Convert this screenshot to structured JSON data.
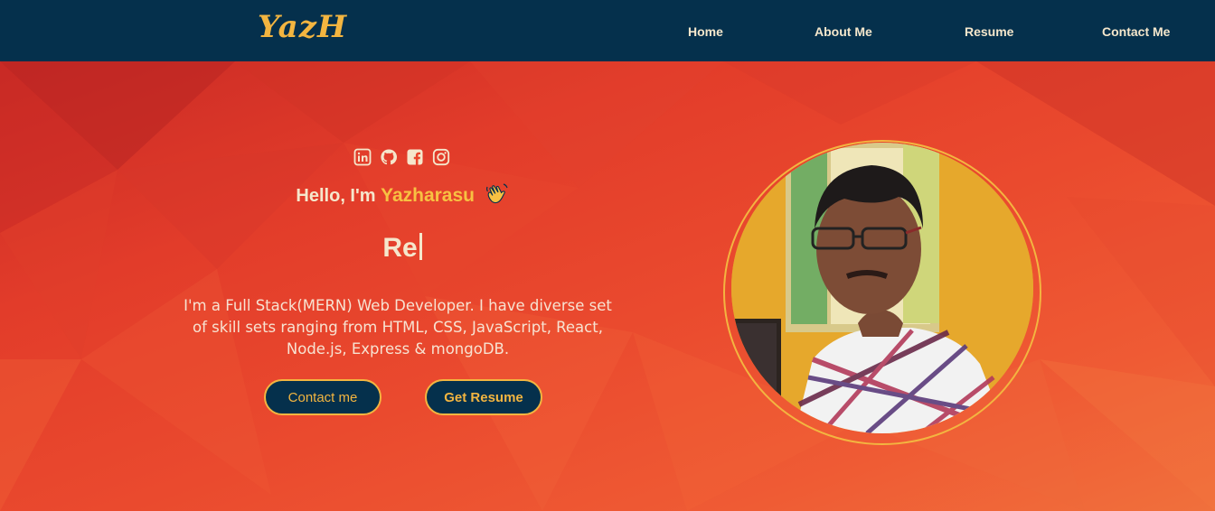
{
  "navbar": {
    "logo": "YazH",
    "links": [
      {
        "label": "Home"
      },
      {
        "label": "About Me"
      },
      {
        "label": "Resume"
      },
      {
        "label": "Contact Me"
      }
    ]
  },
  "hero": {
    "social_icons": [
      "linkedin-icon",
      "github-icon",
      "facebook-icon",
      "instagram-icon"
    ],
    "greeting_prefix": "Hello, I'm ",
    "greeting_name": "Yazharasu",
    "greeting_emoji": "waving-hand-icon",
    "typed_text": "Re",
    "bio": "I'm a Full Stack(MERN) Web Developer. I have diverse set of skill sets ranging from HTML, CSS, JavaScript, React, Node.js, Express & mongoDB.",
    "buttons": {
      "contact": "Contact me",
      "resume": "Get Resume"
    }
  },
  "colors": {
    "navbar_bg": "#05304c",
    "accent_gold": "#f3b540",
    "hero_red": "#e9452b",
    "text_cream": "#f5e7cc"
  }
}
